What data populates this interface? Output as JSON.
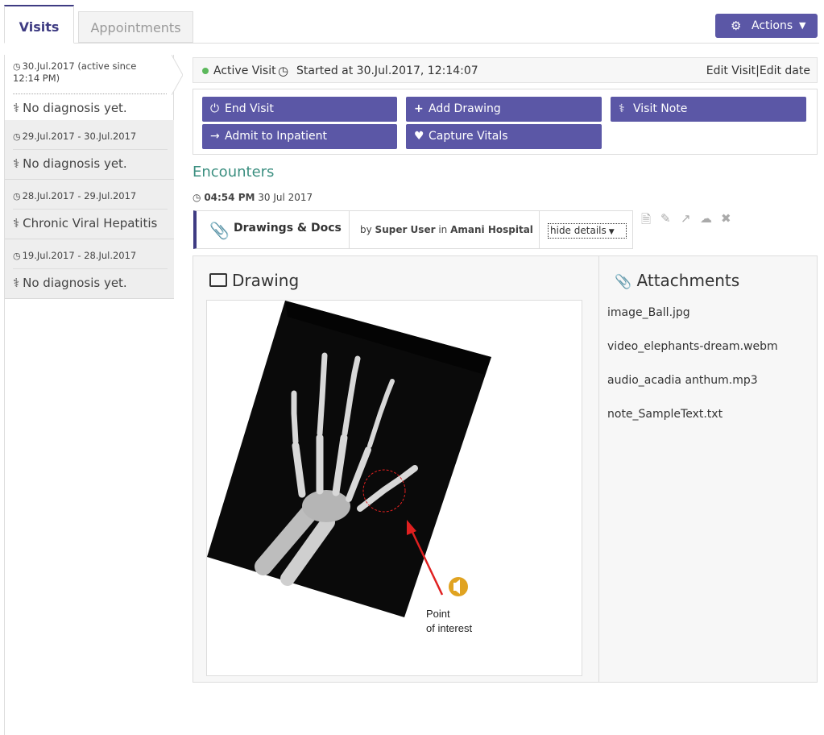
{
  "tabs": [
    {
      "label": "Visits",
      "active": true
    },
    {
      "label": "Appointments",
      "active": false
    }
  ],
  "actions_button": {
    "label": "Actions",
    "icon": "gear-icon"
  },
  "visits": [
    {
      "date": "30.Jul.2017 (active since",
      "date2": "12:14 PM)",
      "diagnosis": "No diagnosis yet.",
      "active": true
    },
    {
      "date": "29.Jul.2017 - 30.Jul.2017",
      "diagnosis": "No diagnosis yet."
    },
    {
      "date": "28.Jul.2017 - 29.Jul.2017",
      "diagnosis": "Chronic Viral Hepatitis"
    },
    {
      "date": "19.Jul.2017 - 28.Jul.2017",
      "diagnosis": "No diagnosis yet."
    }
  ],
  "header": {
    "status": "Active Visit",
    "started": "Started at 30.Jul.2017, 12:14:07",
    "edit_visit": "Edit Visit",
    "separator": "|",
    "edit_date": "Edit date"
  },
  "action_buttons": [
    {
      "label": "End Visit",
      "icon": "power-icon"
    },
    {
      "label": "Add Drawing",
      "icon": "plus-icon"
    },
    {
      "label": "Visit Note",
      "icon": "stethoscope-icon"
    },
    {
      "label": "Admit to Inpatient",
      "icon": "sign-in-icon"
    },
    {
      "label": "Capture Vitals",
      "icon": "heartbeat-icon"
    }
  ],
  "encounters": {
    "title": "Encounters",
    "time": "04:54 PM",
    "date": "30 Jul 2017",
    "encounter_title": "Drawings & Docs",
    "by_prefix": "by",
    "user": "Super User",
    "in_word": "in",
    "location": "Amani Hospital",
    "hide_details": "hide details"
  },
  "details": {
    "drawing_title": "Drawing",
    "annotation_line1": "Point",
    "annotation_line2": "of interest",
    "attachments_title": "Attachments",
    "attachments": [
      "image_Ball.jpg",
      "video_elephants-dream.webm",
      "audio_acadia anthum.mp3",
      "note_SampleText.txt"
    ]
  },
  "colors": {
    "primary": "#5b57a6",
    "accent_dark": "#3e3b82",
    "encounters_title": "#3b8f80",
    "active_dot": "#5cb85c",
    "audio_icon": "#e0a321",
    "annotation_red": "#e02020"
  }
}
